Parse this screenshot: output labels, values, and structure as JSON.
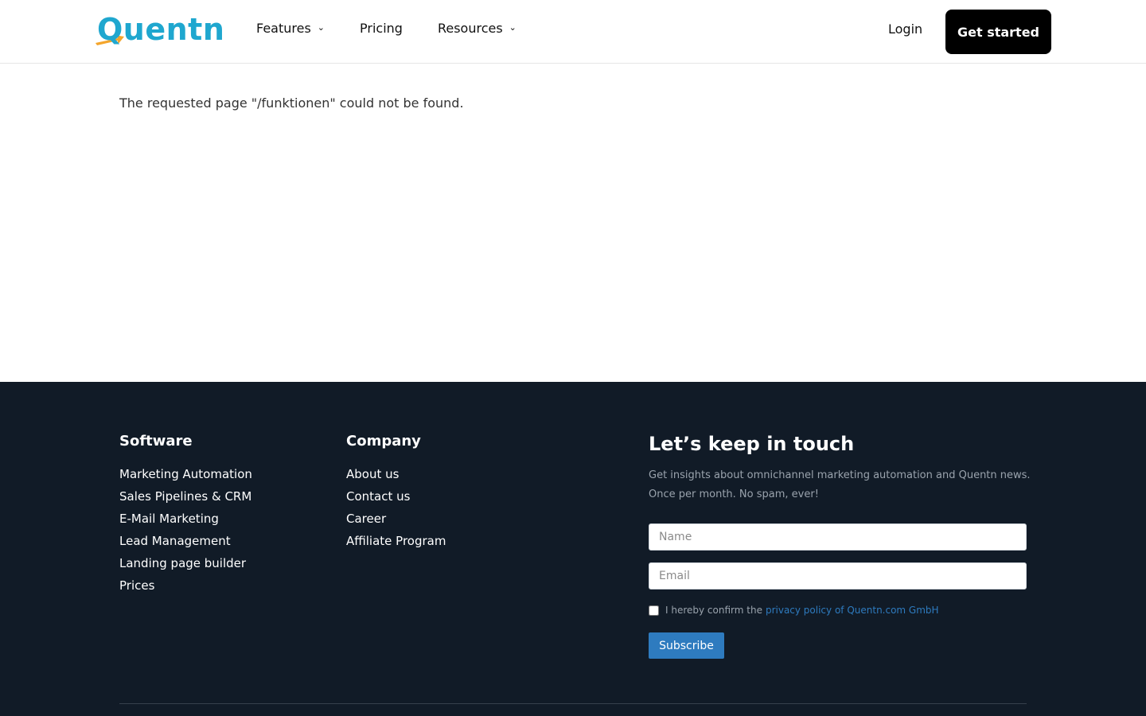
{
  "brand": {
    "logo_text": "Quentn",
    "accent_color": "#1fa7cf",
    "arrow_color": "#f4a52b"
  },
  "nav": {
    "items": [
      {
        "label": "Features",
        "has_dropdown": true
      },
      {
        "label": "Pricing",
        "has_dropdown": false
      },
      {
        "label": "Resources",
        "has_dropdown": true
      }
    ],
    "login_label": "Login",
    "cta_label": "Get started"
  },
  "main": {
    "message": "The requested page \"/funktionen\" could not be found."
  },
  "footer": {
    "software": {
      "title": "Software",
      "links": [
        "Marketing Automation",
        "Sales Pipelines & CRM",
        "E-Mail Marketing",
        "Lead Management",
        "Landing page builder",
        "Prices"
      ]
    },
    "company": {
      "title": "Company",
      "links": [
        "About us",
        "Contact us",
        "Career",
        "Affiliate Program"
      ]
    },
    "newsletter": {
      "title": "Let’s keep in touch",
      "description": "Get insights about omnichannel marketing automation and Quentn news. Once per month. No spam, ever!",
      "name_placeholder": "Name",
      "email_placeholder": "Email",
      "consent_text": "I hereby confirm the",
      "consent_link": "privacy policy of Quentn.com GmbH",
      "subscribe_label": "Subscribe"
    },
    "background_color": "#111b27",
    "button_color": "#2e7bbf"
  }
}
